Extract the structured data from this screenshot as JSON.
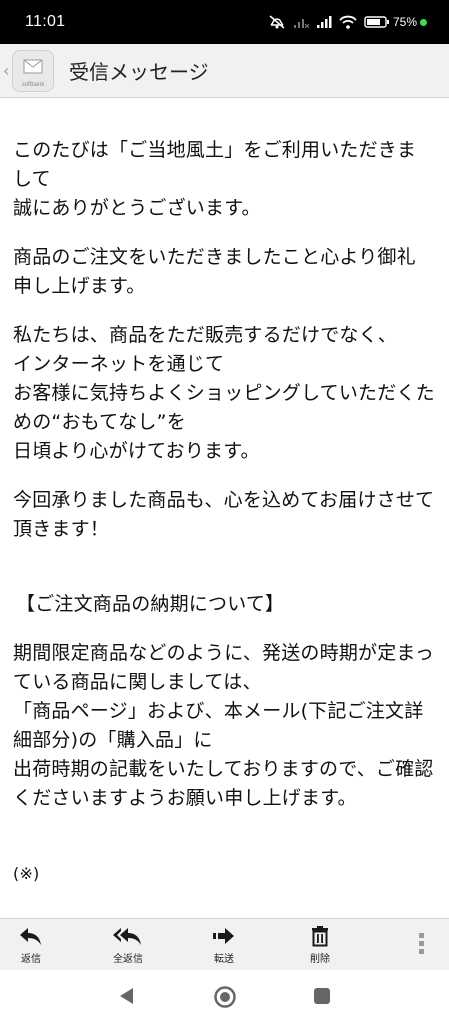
{
  "status_bar": {
    "time": "11:01",
    "battery": "75%",
    "icons": [
      "mute-vibrate-icon",
      "no-signal-icon",
      "signal-icon",
      "wifi-icon",
      "battery-icon",
      "charging-dot-icon"
    ]
  },
  "header": {
    "title": "受信メッセージ",
    "logo_text": "softbank"
  },
  "message": {
    "paragraphs": [
      "このたびは「ご当地風土」をご利用いただきまして\n誠にありがとうございます。",
      "商品のご注文をいただきましたこと心より御礼申し上げます。",
      "私たちは、商品をただ販売するだけでなく、\nインターネットを通じて\nお客様に気持ちよくショッピングしていただくための“おもてなし”を\n日頃より心がけております。",
      "今回承りました商品も、心を込めてお届けさせて頂きます！"
    ],
    "section_heading": "【ご注文商品の納期について】",
    "section_body": "期間限定商品などのように、発送の時期が定まっている商品に関しましては、\n「商品ページ」および、本メール(下記ご注文詳細部分)の「購入品」に\n出荷時期の記載をいたしておりますので、ご確認くださいますようお願い申し上げます。",
    "footnote": "(※)"
  },
  "toolbar": {
    "reply_label": "返信",
    "reply_all_label": "全返信",
    "forward_label": "転送",
    "delete_label": "削除"
  },
  "colors": {
    "status_bar_bg": "#000000",
    "header_bg": "#f1f1f1",
    "charge_dot": "#3ddc58",
    "text": "#111111"
  }
}
